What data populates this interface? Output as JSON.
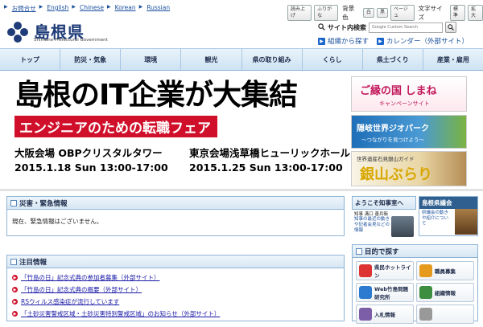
{
  "topbar": {
    "lang_links": [
      "お問合せ",
      "English",
      "Chinese",
      "Korean",
      "Russian"
    ],
    "utility_buttons": [
      "読み上げ",
      "ふりがな"
    ],
    "bg_label": "背景色",
    "bg_buttons": [
      "白",
      "黒",
      "ベージュ"
    ],
    "font_label": "文字サイズ",
    "font_buttons": [
      "標準",
      "拡大"
    ]
  },
  "header": {
    "title": "島根県",
    "subtitle": "Shimane Prefectural Government",
    "search_label": "サイト内検索",
    "search_placeholder": "Google Custom Search",
    "link_org": "組織から探す",
    "link_calendar": "カレンダー（外部サイト）"
  },
  "nav": {
    "items": [
      "トップ",
      "防災・気象",
      "環境",
      "観光",
      "県の取り組み",
      "くらし",
      "県土づくり",
      "産業・雇用"
    ]
  },
  "banner": {
    "title": "島根のIT企業が大集結",
    "subtitle": "エンジニアのための転職フェア",
    "venue1": "大阪会場 OBPクリスタルタワー",
    "venue2": "東京会場浅草橋ヒューリックホール",
    "date1": "2015.1.18  Sun 13:00-17:00",
    "date2": "2015.1.25  Sun 13:00-17:00"
  },
  "promos": {
    "p1_title": "ご縁の国 しまね",
    "p1_sub": "キャンペーンサイト",
    "p2_title": "隠岐世界ジオパーク",
    "p2_sub": "〜つながりを見つけよう〜",
    "p3_title": "世界遺産石見銀山ガイド",
    "p3_main": "銀山ぶらり"
  },
  "disaster": {
    "title": "災害・緊急情報",
    "body": "現在、緊急情報はございません。"
  },
  "notice": {
    "title": "注目情報",
    "items": [
      "「竹島の日」記念式典の参加者募集（外部サイト）",
      "「竹島の日」記念式典の概要（外部サイト）",
      "RSウィルス感染症が流行しています",
      "「土砂災害警戒区域・土砂災害特別警戒区域」のお知らせ（外部サイト）"
    ]
  },
  "welcome": {
    "title": "ようこそ知事室へ",
    "name": "知事 溝口 善兵衛",
    "text": "知事の最近の動きや記者会見などの情報"
  },
  "assembly": {
    "title": "島根県議会",
    "text": "県議会の動きや紹介について"
  },
  "purpose": {
    "title": "目的で探す",
    "tiles": [
      "県民ホットライン",
      "職員募集",
      "Web竹島問題研究所",
      "組織情報",
      "入札情報",
      ""
    ]
  },
  "colors": {
    "brand_blue": "#1f3c79",
    "accent_red": "#d0102b",
    "nav_bg": "#cfe3f3",
    "link": "#1a1aa8"
  }
}
